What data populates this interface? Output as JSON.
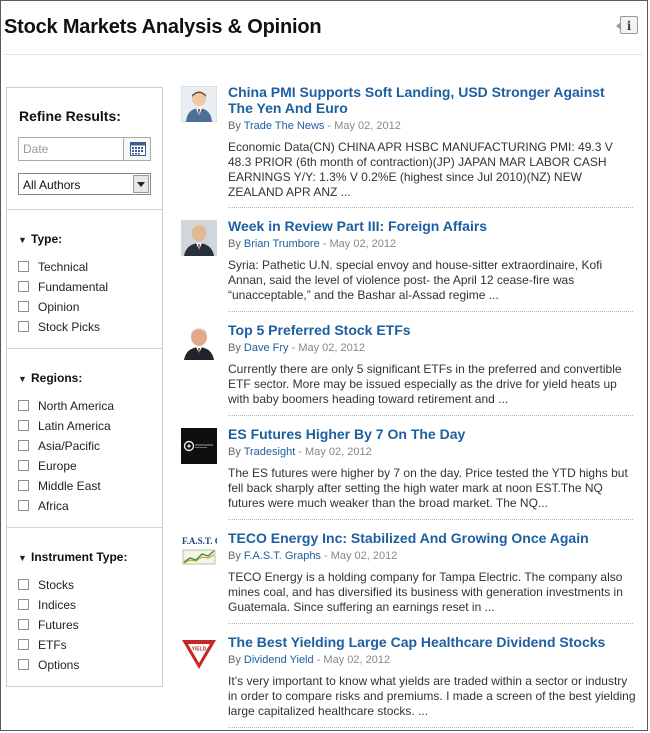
{
  "page": {
    "title": "Stock Markets Analysis & Opinion",
    "info_icon": "info-icon"
  },
  "sidebar": {
    "refine_title": "Refine Results:",
    "date_placeholder": "Date",
    "author_select": {
      "selected": "All Authors"
    },
    "sections": [
      {
        "title": "Type:",
        "items": [
          "Technical",
          "Fundamental",
          "Opinion",
          "Stock Picks"
        ]
      },
      {
        "title": "Regions:",
        "items": [
          "North America",
          "Latin America",
          "Asia/Pacific",
          "Europe",
          "Middle East",
          "Africa"
        ]
      },
      {
        "title": "Instrument Type:",
        "items": [
          "Stocks",
          "Indices",
          "Futures",
          "ETFs",
          "Options"
        ]
      }
    ]
  },
  "articles": [
    {
      "title": "China PMI Supports Soft Landing, USD Stronger Against The Yen And Euro",
      "by": "By",
      "author": "Trade The News",
      "date": "- May 02, 2012",
      "summary": "Economic Data(CN) CHINA APR HSBC MANUFACTURING PMI: 49.3 V 48.3 PRIOR (6th month of contraction)(JP) JAPAN MAR LABOR CASH EARNINGS Y/Y: 1.3% V 0.2%E (highest since Jul 2010)(NZ) NEW ZEALAND APR ANZ ..."
    },
    {
      "title": "Week in Review Part III: Foreign Affairs",
      "by": "By",
      "author": "Brian Trumbore",
      "date": "- May 02, 2012",
      "summary": "Syria: Pathetic U.N. special envoy and house-sitter extraordinaire, Kofi Annan, said the level of violence post- the April 12 cease-fire was “unacceptable,” and the Bashar al-Assad regime ..."
    },
    {
      "title": "Top 5 Preferred Stock ETFs",
      "by": "By",
      "author": "Dave Fry",
      "date": "- May 02, 2012",
      "summary": "Currently there are only 5 significant ETFs in the preferred and convertible ETF sector. More may be issued especially as the drive for yield heats up with baby boomers heading toward retirement and ..."
    },
    {
      "title": "ES Futures Higher By 7 On The Day",
      "by": "By",
      "author": "Tradesight",
      "date": "- May 02, 2012",
      "summary": "The ES futures were higher by 7 on the day. Price tested the YTD highs but fell back sharply after setting the high water mark at noon EST.The NQ futures were much weaker than the broad market. The NQ..."
    },
    {
      "title": "TECO Energy Inc: Stabilized And Growing Once Again",
      "by": "By",
      "author": "F.A.S.T. Graphs",
      "date": "- May 02, 2012",
      "summary": "TECO Energy is a holding company for Tampa Electric. The company also mines coal, and has diversified its business with generation investments in Guatemala. Since suffering an earnings reset in ..."
    },
    {
      "title": "The Best Yielding Large Cap Healthcare Dividend Stocks",
      "by": "By",
      "author": "Dividend Yield",
      "date": "- May 02, 2012",
      "summary": "It’s very important to know what yields are traded within a sector or industry in order to compare risks and premiums. I made a screen of the best yielding large capitalized healthcare stocks. ..."
    }
  ],
  "thumb_logos": {
    "fast_graphs": "F.A.S.T. Graphs",
    "yield_sign": "YIELD"
  },
  "colors": {
    "link": "#1d5fa0",
    "text": "#333333",
    "meta": "#666666"
  }
}
